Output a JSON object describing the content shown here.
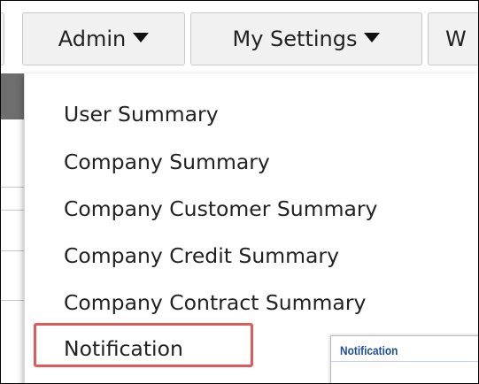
{
  "navbar": {
    "items": [
      {
        "label": "Admin",
        "has_dropdown": true
      },
      {
        "label": "My Settings",
        "has_dropdown": true
      },
      {
        "label": "W",
        "has_dropdown": false
      }
    ]
  },
  "admin_menu": {
    "items": [
      {
        "label": "User Summary"
      },
      {
        "label": "Company Summary"
      },
      {
        "label": "Company Customer Summary"
      },
      {
        "label": "Company Credit Summary"
      },
      {
        "label": "Company Contract Summary"
      },
      {
        "label": "Notification",
        "highlighted": true
      }
    ]
  },
  "notification_panel": {
    "title": "Notification"
  },
  "colors": {
    "highlight_border": "#e05a5a",
    "nav_button_bg": "#f1f1f1",
    "panel_title": "#1f4e9a"
  }
}
